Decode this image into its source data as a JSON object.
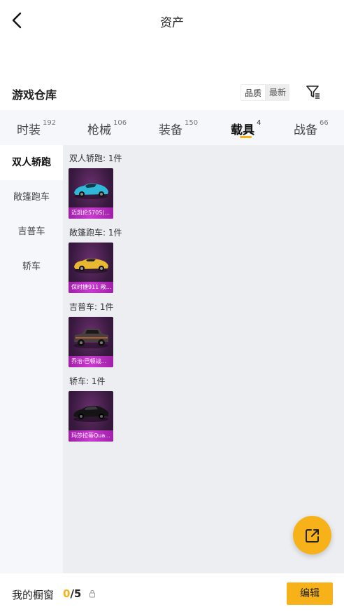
{
  "header": {
    "title": "资产",
    "back_icon": "chevron-left-icon"
  },
  "warehouse": {
    "title": "游戏仓库",
    "sort_options": [
      "品质",
      "最新"
    ],
    "filter_icon": "filter-list-icon"
  },
  "tabs": [
    {
      "label": "时装",
      "count": "192",
      "active": false
    },
    {
      "label": "枪械",
      "count": "106",
      "active": false
    },
    {
      "label": "装备",
      "count": "150",
      "active": false
    },
    {
      "label": "载具",
      "count": "4",
      "active": true
    },
    {
      "label": "战备",
      "count": "66",
      "active": false
    }
  ],
  "sidebar": {
    "items": [
      {
        "label": "双人轿跑",
        "active": true
      },
      {
        "label": "敞篷跑车",
        "active": false
      },
      {
        "label": "吉普车",
        "active": false
      },
      {
        "label": "轿车",
        "active": false
      }
    ]
  },
  "groups": [
    {
      "title": "双人轿跑: 1件",
      "items": [
        {
          "name": "迈凯伦570S(...",
          "car_color": "#2fb8d8"
        }
      ]
    },
    {
      "title": "敞篷跑车: 1件",
      "items": [
        {
          "name": "保时捷911 敞...",
          "car_color": "#e8b830"
        }
      ]
    },
    {
      "title": "吉普车: 1件",
      "items": [
        {
          "name": "乔治·巴顿战...",
          "car_color": "#4a4040"
        }
      ]
    },
    {
      "title": "轿车: 1件",
      "items": [
        {
          "name": "玛莎拉蒂Qua...",
          "car_color": "#141414"
        }
      ]
    }
  ],
  "fab": {
    "icon": "share-external-icon"
  },
  "bottom": {
    "showcase_label": "我的橱窗",
    "current": "0",
    "separator": "/",
    "max": "5",
    "lock_icon": "lock-icon",
    "edit_label": "编辑"
  },
  "colors": {
    "accent": "#f7b21a",
    "card_caption": "#c93bd0",
    "card_bg": "#3a1a40"
  }
}
